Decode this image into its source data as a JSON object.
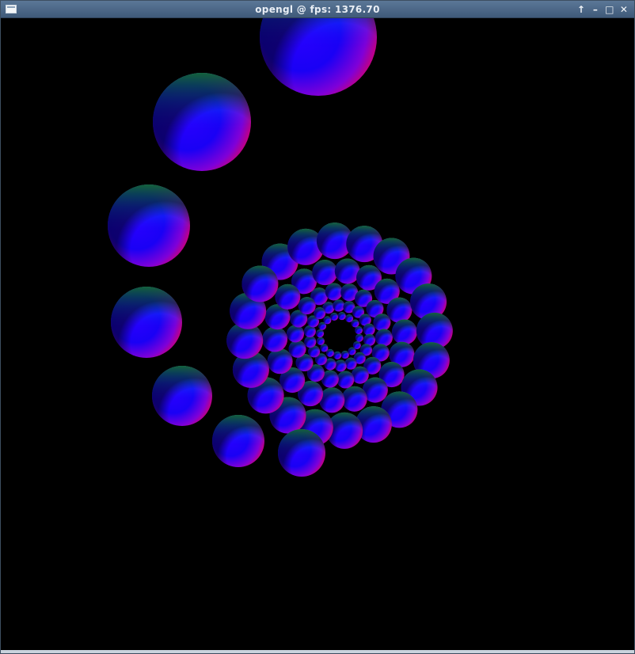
{
  "window": {
    "title": "opengl @ fps: 1376.70",
    "controls": {
      "pin_icon": "arrow-up-icon",
      "minimize_icon": "minimize-icon",
      "maximize_icon": "maximize-icon",
      "close_icon": "close-icon"
    }
  },
  "scene": {
    "background_color": "#000000",
    "sphere_colors": [
      "#0000ff",
      "#ff0000",
      "#00ff00"
    ]
  }
}
